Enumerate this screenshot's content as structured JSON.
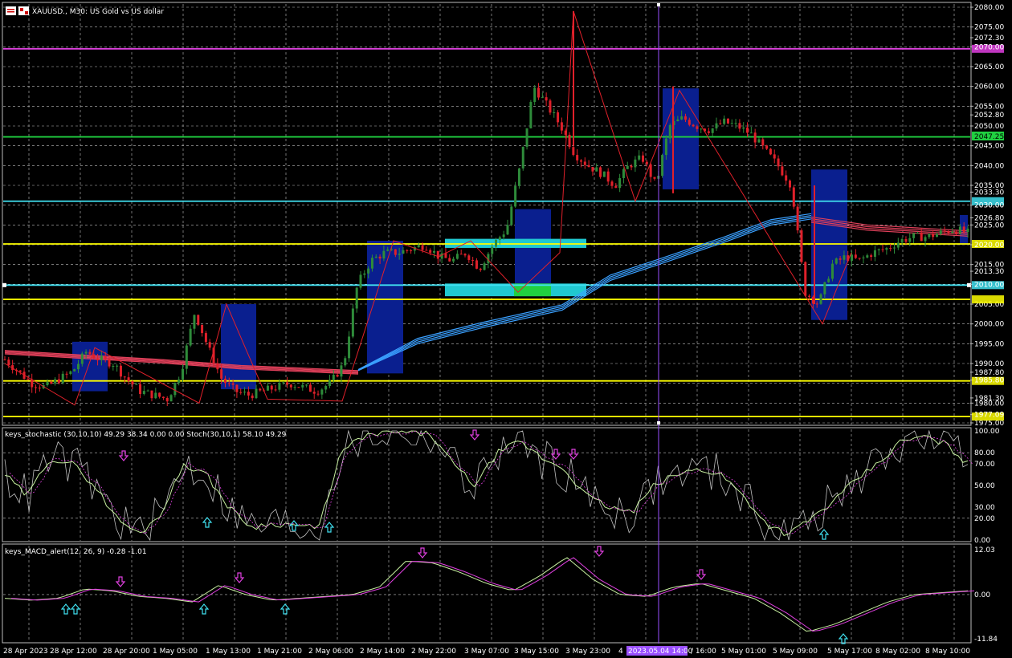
{
  "chart_title": "XAUUSD., M30:  US Gold vs US dollar",
  "stoch_label": "keys_stochastic (30,10,10) 49.29 38.34 0.00 0.00 Stoch(30,10,1) 58.10 49.29",
  "macd_label": "keys_MACD_alert(12, 26, 9) -0.28 -1.01",
  "colors": {
    "background": "#000000",
    "grid": "#c0c0c0",
    "bull_candle": "#2e8b3a",
    "bear_candle": "#e0202a",
    "ma_red": "#e0405a",
    "ma_blue": "#3aa0ff",
    "zone_blue": "#0a1f8f",
    "zone_cyan": "#20c8d0",
    "hline_magenta": "#e040e0",
    "hline_green": "#20d040",
    "hline_cyan": "#40e0f0",
    "hline_yellow": "#ffff00",
    "vline_purple": "#9a50ff",
    "signal_up": "#40e0f0",
    "signal_down": "#e040e0"
  },
  "price_axis": [
    {
      "v": "2080.00"
    },
    {
      "v": "2075.00"
    },
    {
      "v": "2072.30"
    },
    {
      "v": "2070.00"
    },
    {
      "v": "2065.00"
    },
    {
      "v": "2060.00"
    },
    {
      "v": "2055.00"
    },
    {
      "v": "2052.80"
    },
    {
      "v": "2050.00"
    },
    {
      "v": "2045.00"
    },
    {
      "v": "2040.00"
    },
    {
      "v": "2035.00"
    },
    {
      "v": "2033.30"
    },
    {
      "v": "2030.00"
    },
    {
      "v": "2026.80"
    },
    {
      "v": "2025.00"
    },
    {
      "v": "2020.00"
    },
    {
      "v": "2015.00"
    },
    {
      "v": "2013.30"
    },
    {
      "v": "2010.00"
    },
    {
      "v": "2005.00"
    },
    {
      "v": "2000.00"
    },
    {
      "v": "1995.00"
    },
    {
      "v": "1990.00"
    },
    {
      "v": "1987.80"
    },
    {
      "v": "1985.80"
    },
    {
      "v": "1981.30"
    },
    {
      "v": "1980.00"
    },
    {
      "v": "1977.09"
    },
    {
      "v": "1975.00"
    }
  ],
  "current_price_tag": "2047.25",
  "stoch_axis": [
    "100.00",
    "80.00",
    "70.00",
    "50.00",
    "30.00",
    "20.00",
    "0.00"
  ],
  "macd_axis": [
    "12.03",
    "0.00",
    "-11.84"
  ],
  "time_axis": [
    "28 Apr 2023",
    "28 Apr 12:00",
    "28 Apr 20:00",
    "1 May 05:00",
    "1 May 13:00",
    "1 May 21:00",
    "2 May 06:00",
    "2 May 14:00",
    "2 May 22:00",
    "3 May 07:00",
    "3 May 15:00",
    "3 May 23:00",
    "4",
    "2023.05.04 14:00",
    "/ 16:00",
    "5 May 01:00",
    "5 May 09:00",
    "5 May 17:00",
    "8 May 02:00",
    "8 May 10:00"
  ],
  "crosshair_time": "2023.05.04 14:00",
  "chart_data": {
    "type": "candlestick",
    "symbol": "XAUUSD.",
    "timeframe": "M30",
    "ylim": [
      1975,
      2080
    ],
    "horizontal_levels": [
      {
        "price": 2069.5,
        "color": "magenta"
      },
      {
        "price": 2047.25,
        "color": "green"
      },
      {
        "price": 2031.0,
        "color": "cyan"
      },
      {
        "price": 2020.2,
        "color": "yellow"
      },
      {
        "price": 2009.8,
        "color": "cyan"
      },
      {
        "price": 2006.2,
        "color": "yellow"
      },
      {
        "price": 1985.6,
        "color": "yellow"
      },
      {
        "price": 1976.6,
        "color": "yellow"
      }
    ],
    "close_path": [
      1991,
      1988,
      1985,
      1984,
      1986,
      1988,
      1993,
      1991,
      1990,
      1986,
      1983,
      1982,
      1981,
      1988,
      2003,
      1994,
      1986,
      1983,
      1982,
      1983,
      1984,
      1985,
      1984,
      1983,
      1985,
      1990,
      2010,
      2016,
      2018,
      2018,
      2019,
      2020,
      2017,
      2016,
      2018,
      2014,
      2020,
      2024,
      2040,
      2060,
      2055,
      2050,
      2043,
      2040,
      2038,
      2035,
      2040,
      2042,
      2035,
      2050,
      2052,
      2050,
      2049,
      2051,
      2050,
      2048,
      2044,
      2040,
      2035,
      2008,
      2005,
      2015,
      2017,
      2016,
      2018,
      2019,
      2021,
      2022,
      2022,
      2023,
      2024,
      2023
    ]
  }
}
